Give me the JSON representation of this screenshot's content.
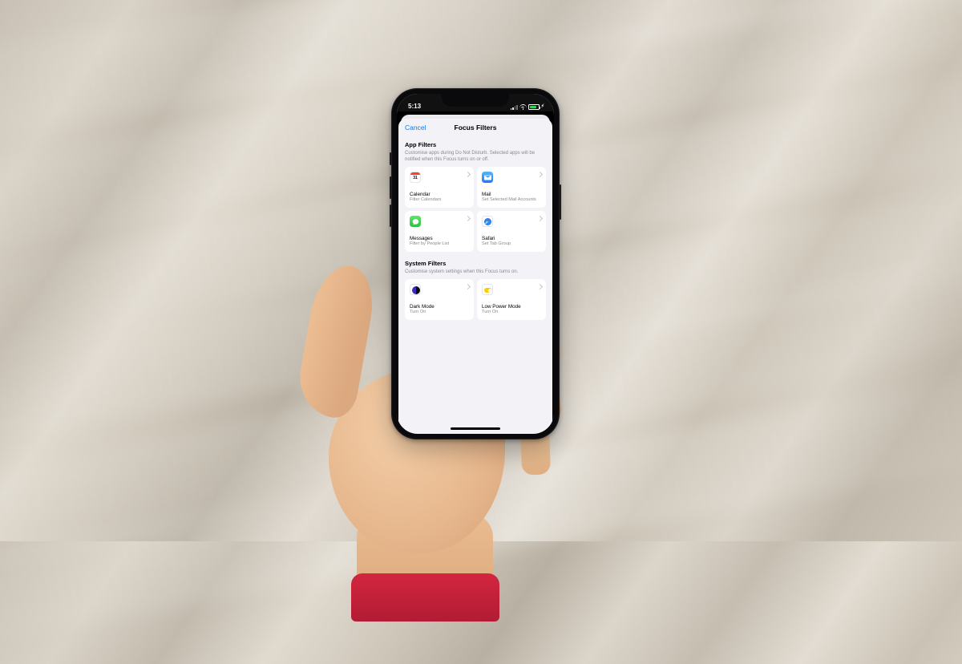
{
  "statusbar": {
    "time": "5:13"
  },
  "sheet": {
    "cancel": "Cancel",
    "title": "Focus Filters",
    "sections": [
      {
        "title": "App Filters",
        "subtitle": "Customise apps during Do Not Disturb. Selected apps will be notified when this Focus turns on or off.",
        "cards": [
          {
            "title": "Calendar",
            "subtitle": "Filter Calendars"
          },
          {
            "title": "Mail",
            "subtitle": "Set Selected Mail Accounts"
          },
          {
            "title": "Messages",
            "subtitle": "Filter by People List"
          },
          {
            "title": "Safari",
            "subtitle": "Set Tab Group"
          }
        ]
      },
      {
        "title": "System Filters",
        "subtitle": "Customise system settings when this Focus turns on.",
        "cards": [
          {
            "title": "Dark Mode",
            "subtitle": "Turn On"
          },
          {
            "title": "Low Power Mode",
            "subtitle": "Turn On"
          }
        ]
      }
    ]
  }
}
